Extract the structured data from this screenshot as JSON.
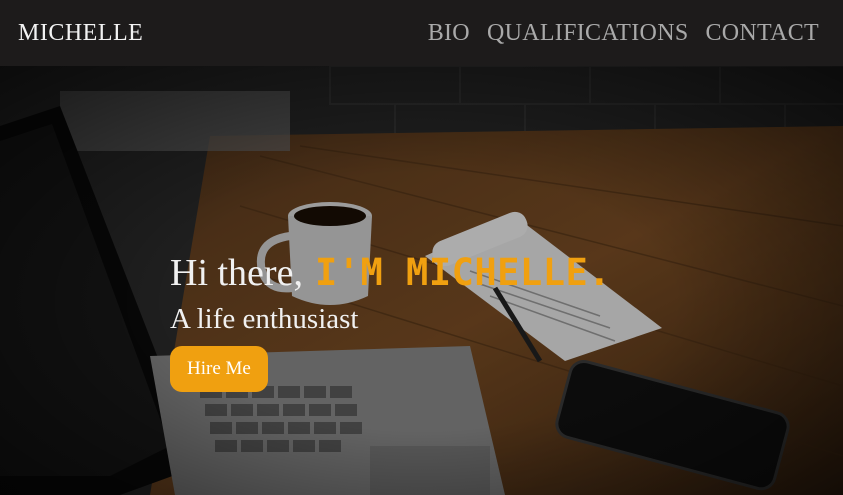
{
  "navbar": {
    "brand": "MICHELLE",
    "links": [
      "BIO",
      "QUALIFICATIONS",
      "CONTACT"
    ]
  },
  "hero": {
    "greeting": "Hi there,",
    "name": "I'M MICHELLE.",
    "tagline": "A life enthusiast",
    "cta_label": "Hire Me"
  },
  "colors": {
    "accent": "#f0a010",
    "nav_background": "#1d1b1b",
    "nav_link": "#a9a9a9"
  }
}
